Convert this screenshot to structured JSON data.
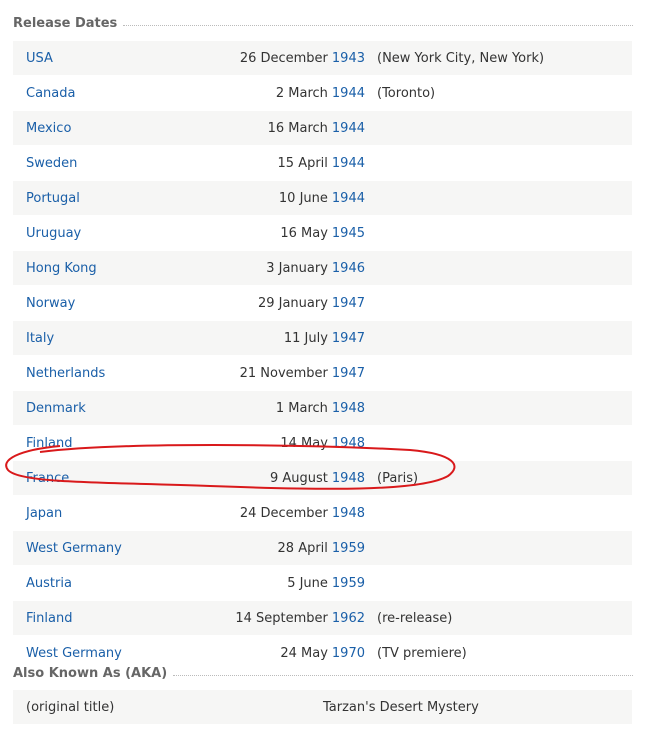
{
  "sections": {
    "release_dates": {
      "title": "Release Dates",
      "rows": [
        {
          "country": "USA",
          "day_month": "26 December",
          "year": "1943",
          "note": "(New York City, New York)"
        },
        {
          "country": "Canada",
          "day_month": "2 March",
          "year": "1944",
          "note": "(Toronto)"
        },
        {
          "country": "Mexico",
          "day_month": "16 March",
          "year": "1944",
          "note": ""
        },
        {
          "country": "Sweden",
          "day_month": "15 April",
          "year": "1944",
          "note": ""
        },
        {
          "country": "Portugal",
          "day_month": "10 June",
          "year": "1944",
          "note": ""
        },
        {
          "country": "Uruguay",
          "day_month": "16 May",
          "year": "1945",
          "note": ""
        },
        {
          "country": "Hong Kong",
          "day_month": "3 January",
          "year": "1946",
          "note": ""
        },
        {
          "country": "Norway",
          "day_month": "29 January",
          "year": "1947",
          "note": ""
        },
        {
          "country": "Italy",
          "day_month": "11 July",
          "year": "1947",
          "note": ""
        },
        {
          "country": "Netherlands",
          "day_month": "21 November",
          "year": "1947",
          "note": ""
        },
        {
          "country": "Denmark",
          "day_month": "1 March",
          "year": "1948",
          "note": ""
        },
        {
          "country": "Finland",
          "day_month": "14 May",
          "year": "1948",
          "note": ""
        },
        {
          "country": "France",
          "day_month": "9 August",
          "year": "1948",
          "note": "(Paris)"
        },
        {
          "country": "Japan",
          "day_month": "24 December",
          "year": "1948",
          "note": ""
        },
        {
          "country": "West Germany",
          "day_month": "28 April",
          "year": "1959",
          "note": ""
        },
        {
          "country": "Austria",
          "day_month": "5 June",
          "year": "1959",
          "note": ""
        },
        {
          "country": "Finland",
          "day_month": "14 September",
          "year": "1962",
          "note": "(re-release)"
        },
        {
          "country": "West Germany",
          "day_month": "24 May",
          "year": "1970",
          "note": "(TV premiere)"
        }
      ]
    },
    "aka": {
      "title": "Also Known As (AKA)",
      "rows": [
        {
          "label": "(original title)",
          "value": "Tarzan's Desert Mystery"
        }
      ]
    }
  },
  "colors": {
    "link": "#1a5fa8",
    "row_alt": "#f6f6f5",
    "annotation": "#d9191b"
  },
  "annotation": {
    "shape": "hand-drawn ellipse",
    "highlighted_row": "France"
  }
}
